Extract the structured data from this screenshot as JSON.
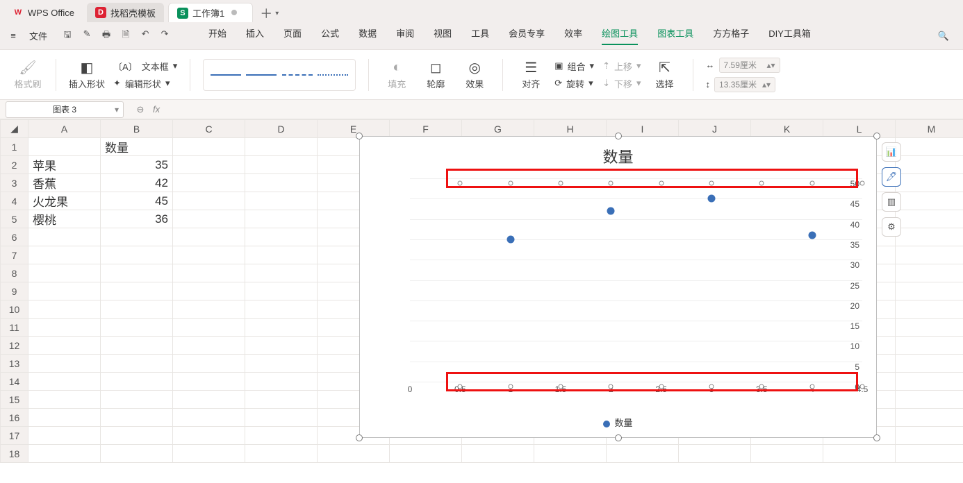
{
  "tabs": {
    "t0": "WPS Office",
    "t1": "找稻壳模板",
    "t2": "工作簿1"
  },
  "menubar": {
    "file": "文件",
    "items": [
      "开始",
      "插入",
      "页面",
      "公式",
      "数据",
      "审阅",
      "视图",
      "工具",
      "会员专享",
      "效率",
      "绘图工具",
      "图表工具",
      "方方格子",
      "DIY工具箱"
    ]
  },
  "ribbon": {
    "format_painter": "格式刷",
    "insert_shape": "插入形状",
    "textbox": "文本框",
    "edit_shape": "编辑形状",
    "fill": "填充",
    "outline": "轮廓",
    "effect": "效果",
    "align": "对齐",
    "group": "组合",
    "rotate": "旋转",
    "move_up": "上移",
    "move_down": "下移",
    "select": "选择",
    "w": "7.59厘米",
    "h": "13.35厘米"
  },
  "namebox": "图表 3",
  "columns": [
    "A",
    "B",
    "C",
    "D",
    "E",
    "F",
    "G",
    "H",
    "I",
    "J",
    "K",
    "L",
    "M"
  ],
  "cells": {
    "B1": "数量",
    "A2": "苹果",
    "B2": "35",
    "A3": "香蕉",
    "B3": "42",
    "A4": "火龙果",
    "B4": "45",
    "A5": "樱桃",
    "B5": "36"
  },
  "chart_data": {
    "type": "scatter",
    "title": "数量",
    "legend": "数量",
    "xlabel": "",
    "ylabel": "",
    "xlim": [
      0,
      4.5
    ],
    "ylim": [
      0,
      50
    ],
    "xticks": [
      0,
      0.5,
      1,
      1.5,
      2,
      2.5,
      3,
      3.5,
      4,
      4.5
    ],
    "yticks": [
      0,
      5,
      10,
      15,
      20,
      25,
      30,
      35,
      40,
      45,
      50
    ],
    "series": [
      {
        "name": "数量",
        "points": [
          {
            "x": 1,
            "y": 35
          },
          {
            "x": 2,
            "y": 42
          },
          {
            "x": 3,
            "y": 45
          },
          {
            "x": 4,
            "y": 36
          }
        ]
      }
    ],
    "highlight_y": [
      50,
      0
    ]
  }
}
